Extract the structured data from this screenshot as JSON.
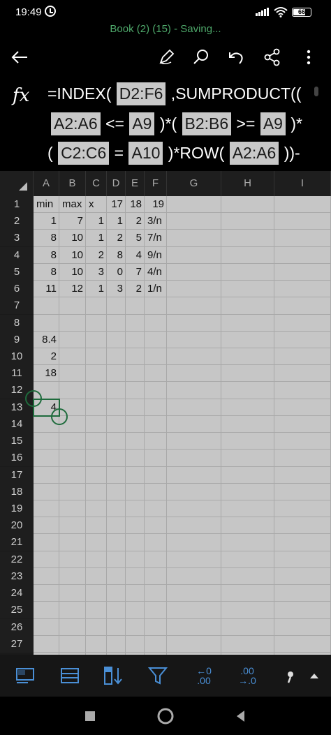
{
  "status": {
    "time": "19:49",
    "battery": "66"
  },
  "document": {
    "title": "Book (2) (15) - Saving..."
  },
  "toolbar": {
    "icons": [
      "back-arrow-icon",
      "pen-icon",
      "search-icon",
      "undo-icon",
      "share-icon",
      "more-vertical-icon"
    ]
  },
  "formula_bar": {
    "fx_label": "fx",
    "line1": [
      {
        "t": "text",
        "v": "=INDEX( "
      },
      {
        "t": "ref",
        "v": "D2:F6"
      },
      {
        "t": "text",
        "v": " ,SUMPRODUCT(("
      }
    ],
    "line2": [
      {
        "t": "ref",
        "v": "A2:A6"
      },
      {
        "t": "text",
        "v": " <= "
      },
      {
        "t": "ref",
        "v": "A9"
      },
      {
        "t": "text",
        "v": " )*( "
      },
      {
        "t": "ref",
        "v": "B2:B6"
      },
      {
        "t": "text",
        "v": " >= "
      },
      {
        "t": "ref",
        "v": "A9"
      },
      {
        "t": "text",
        "v": " )*"
      }
    ],
    "line3": [
      {
        "t": "text",
        "v": "( "
      },
      {
        "t": "ref",
        "v": "C2:C6"
      },
      {
        "t": "text",
        "v": " = "
      },
      {
        "t": "ref",
        "v": "A10"
      },
      {
        "t": "text",
        "v": " )*ROW( "
      },
      {
        "t": "ref",
        "v": "A2:A6"
      },
      {
        "t": "text",
        "v": " ))-"
      }
    ]
  },
  "sheet": {
    "columns": [
      "A",
      "B",
      "C",
      "D",
      "E",
      "F",
      "G",
      "H",
      "I"
    ],
    "rows": [
      "1",
      "2",
      "3",
      "4",
      "5",
      "6",
      "7",
      "8",
      "9",
      "10",
      "11",
      "12",
      "13",
      "14",
      "15",
      "16",
      "17",
      "18",
      "19",
      "20",
      "21",
      "22",
      "23",
      "24",
      "25",
      "26",
      "27"
    ],
    "cells": [
      {
        "row": 1,
        "col": "A",
        "v": "min",
        "align": "txt"
      },
      {
        "row": 1,
        "col": "B",
        "v": "max",
        "align": "txt"
      },
      {
        "row": 1,
        "col": "C",
        "v": "x",
        "align": "txt"
      },
      {
        "row": 1,
        "col": "D",
        "v": "17",
        "align": "num"
      },
      {
        "row": 1,
        "col": "E",
        "v": "18",
        "align": "num"
      },
      {
        "row": 1,
        "col": "F",
        "v": "19",
        "align": "num"
      },
      {
        "row": 2,
        "col": "A",
        "v": "1",
        "align": "num"
      },
      {
        "row": 2,
        "col": "B",
        "v": "7",
        "align": "num"
      },
      {
        "row": 2,
        "col": "C",
        "v": "1",
        "align": "num"
      },
      {
        "row": 2,
        "col": "D",
        "v": "1",
        "align": "num"
      },
      {
        "row": 2,
        "col": "E",
        "v": "2",
        "align": "num"
      },
      {
        "row": 2,
        "col": "F",
        "v": "3/n",
        "align": "txt"
      },
      {
        "row": 3,
        "col": "A",
        "v": "8",
        "align": "num"
      },
      {
        "row": 3,
        "col": "B",
        "v": "10",
        "align": "num"
      },
      {
        "row": 3,
        "col": "C",
        "v": "1",
        "align": "num"
      },
      {
        "row": 3,
        "col": "D",
        "v": "2",
        "align": "num"
      },
      {
        "row": 3,
        "col": "E",
        "v": "5",
        "align": "num"
      },
      {
        "row": 3,
        "col": "F",
        "v": "7/n",
        "align": "txt"
      },
      {
        "row": 4,
        "col": "A",
        "v": "8",
        "align": "num"
      },
      {
        "row": 4,
        "col": "B",
        "v": "10",
        "align": "num"
      },
      {
        "row": 4,
        "col": "C",
        "v": "2",
        "align": "num"
      },
      {
        "row": 4,
        "col": "D",
        "v": "8",
        "align": "num"
      },
      {
        "row": 4,
        "col": "E",
        "v": "4",
        "align": "num"
      },
      {
        "row": 4,
        "col": "F",
        "v": "9/n",
        "align": "txt"
      },
      {
        "row": 5,
        "col": "A",
        "v": "8",
        "align": "num"
      },
      {
        "row": 5,
        "col": "B",
        "v": "10",
        "align": "num"
      },
      {
        "row": 5,
        "col": "C",
        "v": "3",
        "align": "num"
      },
      {
        "row": 5,
        "col": "D",
        "v": "0",
        "align": "num"
      },
      {
        "row": 5,
        "col": "E",
        "v": "7",
        "align": "num"
      },
      {
        "row": 5,
        "col": "F",
        "v": "4/n",
        "align": "txt"
      },
      {
        "row": 6,
        "col": "A",
        "v": "11",
        "align": "num"
      },
      {
        "row": 6,
        "col": "B",
        "v": "12",
        "align": "num"
      },
      {
        "row": 6,
        "col": "C",
        "v": "1",
        "align": "num"
      },
      {
        "row": 6,
        "col": "D",
        "v": "3",
        "align": "num"
      },
      {
        "row": 6,
        "col": "E",
        "v": "2",
        "align": "num"
      },
      {
        "row": 6,
        "col": "F",
        "v": "1/n",
        "align": "txt"
      },
      {
        "row": 9,
        "col": "A",
        "v": "8.4",
        "align": "num"
      },
      {
        "row": 10,
        "col": "A",
        "v": "2",
        "align": "num"
      },
      {
        "row": 11,
        "col": "A",
        "v": "18",
        "align": "num"
      },
      {
        "row": 13,
        "col": "A",
        "v": "4",
        "align": "num"
      }
    ],
    "selected_cell": "A13"
  },
  "bottom_toolbar": {
    "icons": [
      "sheet-view-icon",
      "freeze-panes-icon",
      "sort-icon",
      "filter-icon",
      "increase-decimal-icon",
      "decrease-decimal-icon",
      "format-icon",
      "expand-up-icon"
    ],
    "increase_decimal": {
      "top": "←0",
      "bottom": ".00"
    },
    "decrease_decimal": {
      "top": ".00",
      "bottom": "→.0"
    }
  },
  "nav": {
    "icons": [
      "recents-square-icon",
      "home-circle-icon",
      "back-triangle-icon"
    ]
  }
}
